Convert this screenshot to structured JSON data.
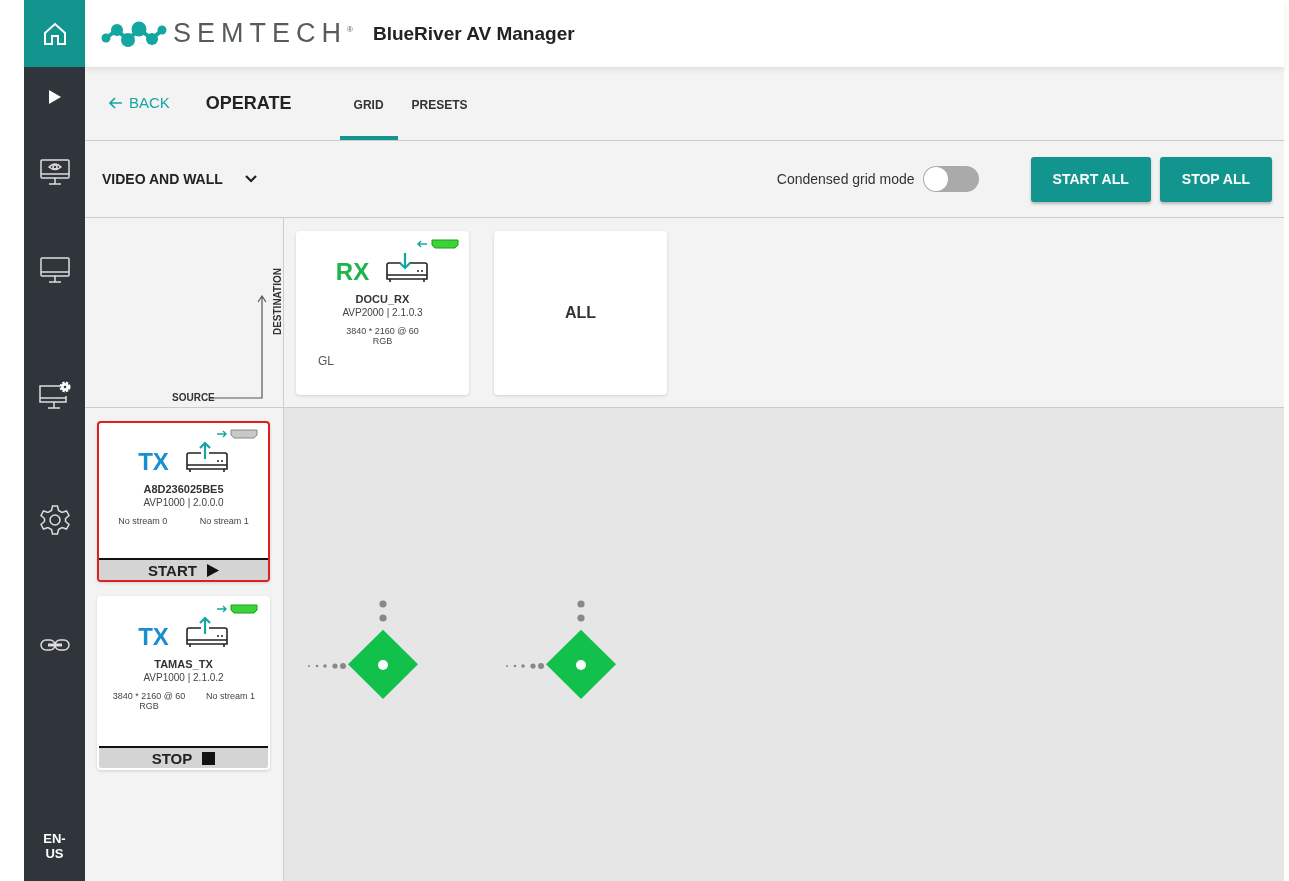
{
  "sidebar": {
    "items": [
      {
        "kind": "home",
        "selected": true
      },
      {
        "kind": "play",
        "selected": false
      },
      {
        "kind": "monitor-eye",
        "selected": false
      },
      {
        "kind": "monitor",
        "selected": false
      },
      {
        "kind": "monitor-gear",
        "selected": false
      },
      {
        "kind": "gear",
        "selected": false
      },
      {
        "kind": "link",
        "selected": false
      }
    ],
    "language": "EN-US"
  },
  "header": {
    "logo": "SEMTECH",
    "registered": "®",
    "app_title": "BlueRiver AV Manager"
  },
  "nav": {
    "back": "BACK",
    "title": "OPERATE",
    "tabs": [
      {
        "label": "GRID",
        "selected": true
      },
      {
        "label": "PRESETS",
        "selected": false
      }
    ]
  },
  "toolbar": {
    "dropdown": "VIDEO AND WALL",
    "toggle": {
      "label": "Condensed grid mode",
      "on": false
    },
    "buttons": [
      "START ALL",
      "STOP ALL"
    ]
  },
  "axis": {
    "destination": "DESTINATION",
    "source": "SOURCE"
  },
  "destinations": [
    {
      "type": "RX",
      "name": "DOCU_RX",
      "model": "AVP2000 | 2.1.0.3",
      "streams": [
        "3840 * 2160 @ 60 RGB"
      ],
      "tag": "GL",
      "connected": true
    }
  ],
  "all_card": "ALL",
  "sources": [
    {
      "type": "TX",
      "name": "A8D236025BE5",
      "model": "AVP1000 | 2.0.0.0",
      "streams": [
        "No stream 0",
        "No stream 1"
      ],
      "connected": false,
      "selected": true,
      "action": {
        "kind": "start",
        "label": "START"
      },
      "cells": [
        {
          "kind": "none"
        },
        {
          "kind": "none"
        }
      ]
    },
    {
      "type": "TX",
      "name": "TAMAS_TX",
      "model": "AVP1000 | 2.1.0.2",
      "streams": [
        "3840 * 2160 @ 60 RGB",
        "No stream 1"
      ],
      "connected": true,
      "selected": false,
      "action": {
        "kind": "stop",
        "label": "STOP"
      },
      "cells": [
        {
          "kind": "connected"
        },
        {
          "kind": "connected"
        }
      ]
    }
  ]
}
